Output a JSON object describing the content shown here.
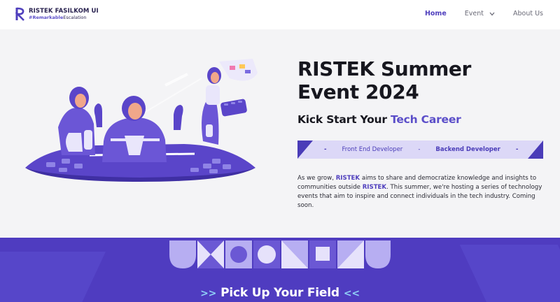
{
  "nav": {
    "brand_name": "RISTEK FASILKOM UI",
    "brand_tag_bold": "#Remarkable",
    "brand_tag_rest": "Escalation",
    "links": [
      {
        "label": "Home",
        "active": true
      },
      {
        "label": "Event",
        "has_dropdown": true
      },
      {
        "label": "About Us"
      }
    ]
  },
  "hero": {
    "title_line1": "RISTEK Summer",
    "title_line2": "Event 2024",
    "subtitle_prefix": "Kick Start Your ",
    "subtitle_accent": "Tech Career",
    "roles": [
      "Front End Developer",
      "Backend Developer"
    ],
    "separator": "-",
    "desc": {
      "p1": "As we grow, ",
      "b1": "RISTEK",
      "p2": " aims to share and democratize knowledge and insights to communities outside ",
      "b2": "RISTEK",
      "p3": ". This summer, we're hosting a series of technology events that aim to inspire and connect individuals in the tech industry. Coming soon."
    }
  },
  "section": {
    "title": "Pick Up Your Field",
    "arrow_left": ">>",
    "arrow_right": "<<"
  },
  "colors": {
    "accent": "#5b4ec9",
    "accent_dark": "#4a3cb8",
    "band": "#4f3cc0",
    "role_bar": "#dcd8f7"
  },
  "icons": [
    "chevron-down-icon",
    "ristek-logo-icon"
  ]
}
